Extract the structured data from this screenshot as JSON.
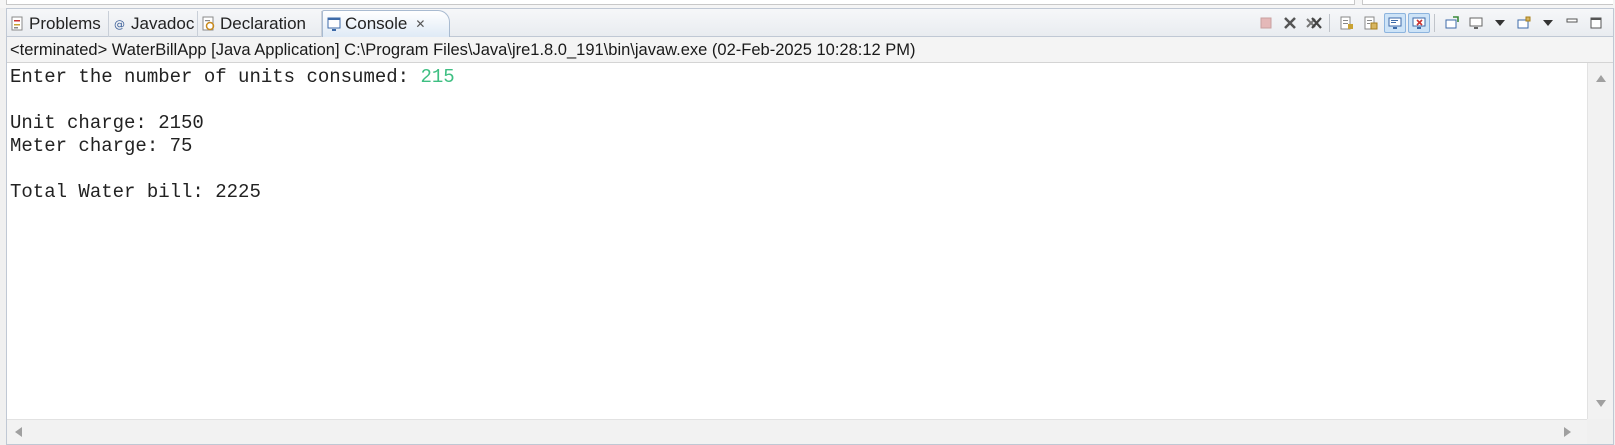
{
  "tabs": [
    {
      "label": "Problems",
      "icon": "problems-icon"
    },
    {
      "label": "Javadoc",
      "icon": "javadoc-icon"
    },
    {
      "label": "Declaration",
      "icon": "declaration-icon"
    },
    {
      "label": "Console",
      "icon": "console-icon",
      "active": true
    }
  ],
  "tab_close_glyph": "✕",
  "launch_description": "<terminated> WaterBillApp [Java Application] C:\\Program Files\\Java\\jre1.8.0_191\\bin\\javaw.exe (02-Feb-2025 10:28:12 PM)",
  "console": {
    "prompt": "Enter the number of units consumed: ",
    "input": "215",
    "lines": [
      "",
      "Unit charge: 2150",
      "Meter charge: 75",
      "",
      "Total Water bill: 2225"
    ]
  },
  "toolbar_icons": [
    "terminate-icon",
    "remove-launch-icon",
    "remove-all-terminated-icon",
    "scroll-lock-icon",
    "word-wrap-icon",
    "show-console-on-output-icon",
    "show-console-on-error-icon",
    "pin-console-icon",
    "display-selected-console-icon",
    "display-selected-console-dropdown-icon",
    "open-console-icon",
    "open-console-dropdown-icon",
    "view-menu-icon",
    "minimize-icon",
    "maximize-icon"
  ],
  "colors": {
    "input_text": "#3ebf82",
    "active_tab": "#dfeaf6",
    "terminate_disabled": "#c04040"
  }
}
